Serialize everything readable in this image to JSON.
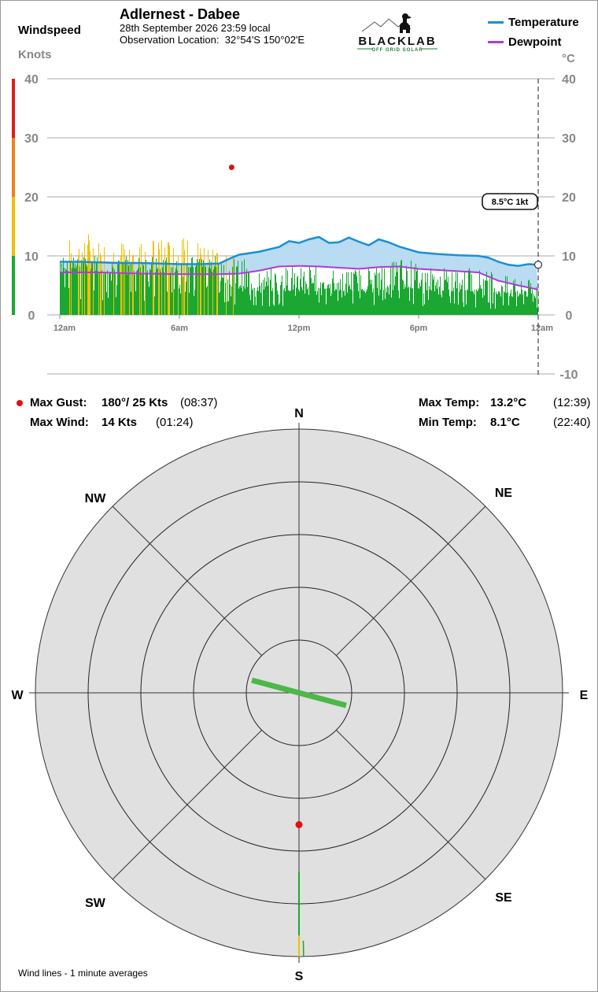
{
  "header": {
    "station": "Adlernest - Dabee",
    "datetime": "28th September 2026  23:59 local",
    "location_label": "Observation Location:",
    "location": "32°54'S 150°02'E"
  },
  "logo": {
    "text": "BLACKLAB",
    "tagline": "OFF GRID SOLAR"
  },
  "legend": {
    "temperature": "Temperature",
    "dewpoint": "Dewpoint"
  },
  "colors": {
    "temperature": "#1a8fd6",
    "temp_fill": "#b9dcf2",
    "dewpoint": "#b03ad6",
    "wind_green": "#1aa832",
    "wind_yellow": "#f0c000",
    "wind_orange": "#f08020",
    "wind_red": "#dc1e1e",
    "gust_marker": "#e01010",
    "rose_fill": "#e0e0e0"
  },
  "chart_data": {
    "type": "line",
    "title": "Windspeed",
    "x_ticks": [
      "12am",
      "6am",
      "12pm",
      "6pm",
      "12am"
    ],
    "x_tick_hours": [
      0,
      6,
      12,
      18,
      24
    ],
    "wind_axis": {
      "label": "Windspeed",
      "unit": "Knots",
      "ticks": [
        0,
        10,
        20,
        30,
        40
      ],
      "range": [
        0,
        40
      ]
    },
    "temp_axis": {
      "unit": "°C",
      "ticks": [
        -10,
        0,
        10,
        20,
        30,
        40
      ],
      "range": [
        -10,
        40
      ]
    },
    "wind_bands": [
      {
        "from": 0,
        "to": 10,
        "color": "wind_green"
      },
      {
        "from": 10,
        "to": 20,
        "color": "wind_yellow"
      },
      {
        "from": 20,
        "to": 30,
        "color": "wind_orange"
      },
      {
        "from": 30,
        "to": 40,
        "color": "wind_red"
      }
    ],
    "series": [
      {
        "name": "Temperature",
        "x_hours": [
          0,
          1,
          2,
          3,
          4,
          5,
          6,
          7,
          8,
          8.5,
          9,
          10,
          11,
          11.5,
          12,
          12.5,
          13,
          13.5,
          14,
          14.5,
          15,
          15.5,
          16,
          16.5,
          17,
          18,
          19,
          20,
          21,
          21.5,
          22,
          22.5,
          23,
          23.5,
          24
        ],
        "values": [
          9.0,
          9.0,
          8.9,
          8.8,
          8.8,
          8.7,
          8.6,
          8.6,
          8.7,
          9.5,
          10.2,
          10.7,
          11.5,
          12.5,
          12.2,
          12.8,
          13.2,
          12.2,
          12.3,
          13.1,
          12.4,
          11.8,
          12.8,
          12.3,
          11.6,
          10.6,
          10.3,
          10.1,
          10.0,
          9.7,
          9.0,
          8.5,
          8.3,
          8.6,
          8.5
        ],
        "color": "temperature"
      },
      {
        "name": "Dewpoint",
        "x_hours": [
          0,
          2,
          4,
          6,
          7,
          8,
          9,
          10,
          11,
          12,
          13,
          14,
          15,
          16,
          17,
          18,
          19,
          20,
          21,
          22,
          23,
          24
        ],
        "values": [
          7.2,
          7.2,
          7.0,
          6.9,
          6.9,
          6.9,
          7.0,
          7.5,
          8.2,
          8.3,
          8.2,
          8.0,
          7.8,
          8.1,
          8.2,
          7.8,
          7.6,
          7.4,
          7.2,
          5.8,
          5.0,
          4.3
        ],
        "color": "dewpoint"
      },
      {
        "name": "Wind",
        "x_hours": [
          0,
          1,
          1.4,
          2,
          3,
          4,
          5,
          6,
          6.5,
          7,
          7.5,
          8,
          8.5,
          9,
          10,
          11,
          12,
          12.5,
          13,
          14,
          15,
          16,
          17,
          18,
          19,
          20,
          21,
          22,
          23,
          24
        ],
        "avg_values": [
          7,
          8,
          8,
          7,
          7,
          7,
          7,
          7,
          8,
          8,
          8,
          6,
          5,
          4,
          4,
          4,
          4,
          4,
          4,
          4,
          4,
          4,
          5,
          4,
          4,
          4,
          4,
          3,
          3,
          3
        ],
        "peak_values": [
          13,
          13,
          14,
          13,
          13,
          13,
          13,
          13,
          13,
          13,
          13,
          12,
          11,
          10,
          8,
          8,
          9,
          9,
          8,
          8,
          8,
          9,
          10,
          9,
          8,
          8,
          8,
          7,
          6,
          6
        ],
        "color": "wind_green"
      }
    ],
    "gust_point": {
      "hour": 8.62,
      "value": 25
    },
    "current_marker": {
      "hour": 24,
      "value": 8.5
    },
    "current_label": "8.5°C  1kt"
  },
  "stats": {
    "max_gust_label": "Max Gust:",
    "max_gust_value": "180°/  25 Kts",
    "max_gust_time": "(08:37)",
    "max_wind_label": "Max Wind:",
    "max_wind_value": "14 Kts",
    "max_wind_time": "(01:24)",
    "max_temp_label": "Max Temp:",
    "max_temp_value": "13.2°C",
    "max_temp_time": "(12:39)",
    "min_temp_label": "Min Temp:",
    "min_temp_value": "8.1°C",
    "min_temp_time": "(22:40)"
  },
  "rose": {
    "directions": [
      "N",
      "NE",
      "E",
      "SE",
      "S",
      "SW",
      "W",
      "NW"
    ],
    "ring_count": 5,
    "ring_max_kts": 25,
    "current_wind": {
      "dir_deg": 285,
      "from_kts": 1,
      "to_kts": 1,
      "color": "wind_green"
    },
    "gust": {
      "dir_deg": 180,
      "kts": 25
    },
    "spokes": [
      {
        "dir_deg": 180,
        "from_kts": 17,
        "to_kts": 25,
        "color": "wind_green"
      },
      {
        "dir_deg": 180,
        "from_kts": 23,
        "to_kts": 25,
        "color": "wind_yellow"
      },
      {
        "dir_deg": 179,
        "from_kts": 23.5,
        "to_kts": 25,
        "color": "wind_green"
      }
    ]
  },
  "footnote": "Wind lines - 1 minute averages"
}
